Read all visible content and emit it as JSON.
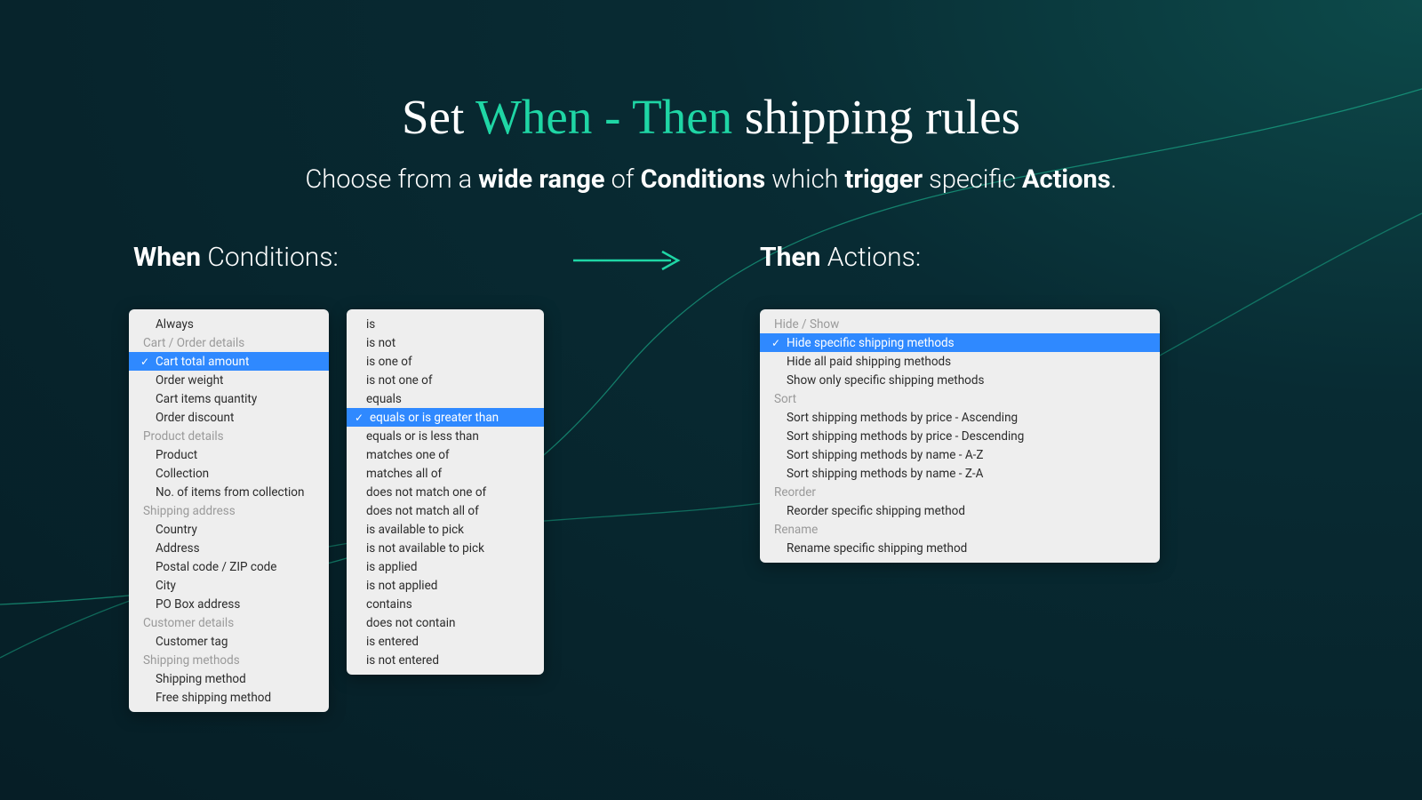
{
  "headline": {
    "p1": "Set ",
    "accent": "When - Then",
    "p2": " shipping rules"
  },
  "subhead": {
    "p1": "Choose from a ",
    "b1": "wide range",
    "p2": " of ",
    "b2": "Conditions",
    "p3": " which ",
    "b3": "trigger",
    "p4": " specific ",
    "b4": "Actions",
    "p5": "."
  },
  "labels": {
    "when_b": "When",
    "when_t": " Conditions:",
    "then_b": "Then",
    "then_t": " Actions:"
  },
  "conditions": {
    "selected": "Cart total amount",
    "groups": [
      {
        "items": [
          "Always"
        ]
      },
      {
        "header": "Cart / Order details",
        "items": [
          "Cart total amount",
          "Order weight",
          "Cart items quantity",
          "Order discount"
        ]
      },
      {
        "header": "Product details",
        "items": [
          "Product",
          "Collection",
          "No. of items from collection"
        ]
      },
      {
        "header": "Shipping address",
        "items": [
          "Country",
          "Address",
          "Postal code / ZIP code",
          "City",
          "PO Box address"
        ]
      },
      {
        "header": "Customer details",
        "items": [
          "Customer tag"
        ]
      },
      {
        "header": "Shipping methods",
        "items": [
          "Shipping method",
          "Free shipping method"
        ]
      }
    ]
  },
  "operators": {
    "selected": "equals or is greater than",
    "items": [
      "is",
      "is not",
      "is one of",
      "is not one of",
      "equals",
      "equals or is greater than",
      "equals or is less than",
      "matches one of",
      "matches all of",
      "does not match one of",
      "does not match all of",
      "is available to pick",
      "is not available to pick",
      "is applied",
      "is not applied",
      "contains",
      "does not contain",
      "is entered",
      "is not entered"
    ]
  },
  "actions": {
    "selected": "Hide specific shipping methods",
    "groups": [
      {
        "header": "Hide / Show",
        "items": [
          "Hide specific shipping methods",
          "Hide all paid shipping methods",
          "Show only specific shipping methods"
        ]
      },
      {
        "header": "Sort",
        "items": [
          "Sort shipping methods by price - Ascending",
          "Sort shipping methods by price - Descending",
          "Sort shipping methods by name - A-Z",
          "Sort shipping methods by name - Z-A"
        ]
      },
      {
        "header": "Reorder",
        "items": [
          "Reorder specific shipping method"
        ]
      },
      {
        "header": "Rename",
        "items": [
          "Rename specific shipping method"
        ]
      }
    ]
  },
  "colors": {
    "accent": "#1fd6a5",
    "select": "#2f89ff"
  }
}
